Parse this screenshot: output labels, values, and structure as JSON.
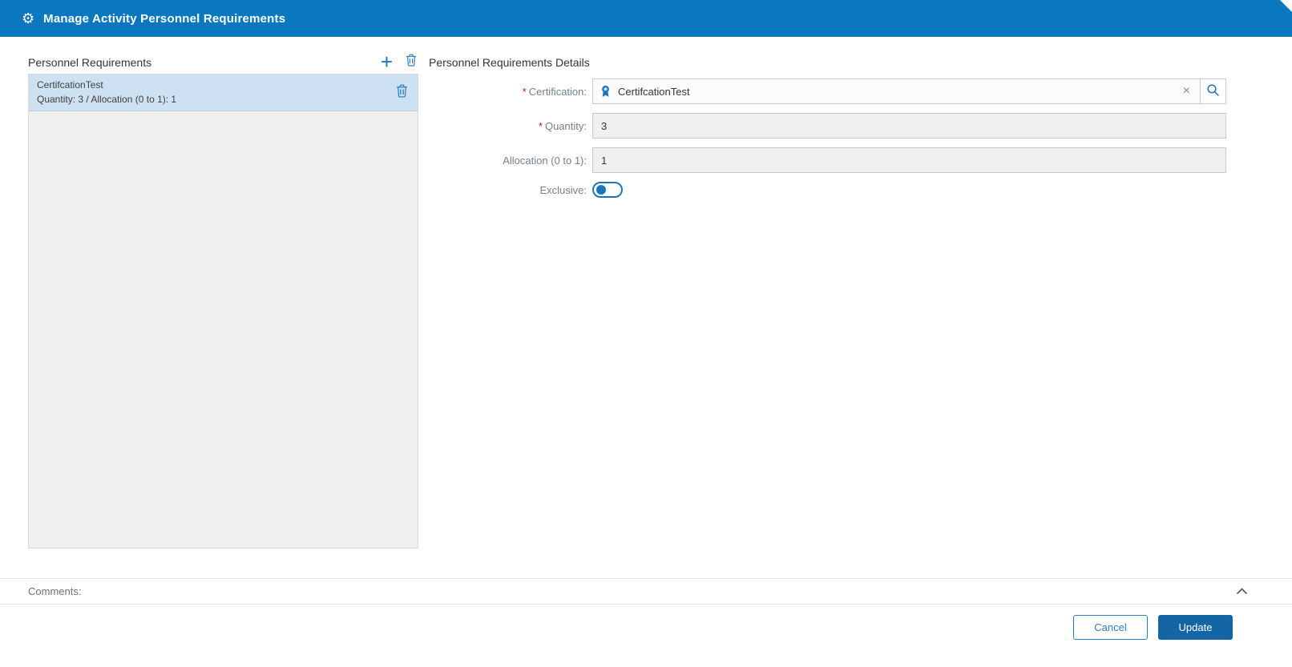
{
  "colors": {
    "header_bg": "#0a78be",
    "accent_blue": "#1b75bb",
    "selected_item_bg": "#cde1f2",
    "input_bg": "#f0f0f0",
    "update_button_bg": "#1465a4",
    "cancel_button_border": "#2a7fc0",
    "required_red": "#b42025"
  },
  "icons": {
    "gear": "⚙",
    "plus": "+",
    "clear": "×"
  },
  "header": {
    "title": "Manage Activity Personnel Requirements"
  },
  "left_panel": {
    "title": "Personnel Requirements",
    "items": [
      {
        "name": "CertifcationTest",
        "details": "Quantity: 3 /  Allocation (0 to 1): 1"
      }
    ]
  },
  "details": {
    "title": "Personnel Requirements Details",
    "certification": {
      "required": "*",
      "label": "Certification:",
      "value": "CertifcationTest"
    },
    "quantity": {
      "required": "*",
      "label": "Quantity:",
      "value": "3"
    },
    "allocation": {
      "label": "Allocation (0 to 1):",
      "value": "1"
    },
    "exclusive": {
      "label": "Exclusive:",
      "state": "off"
    }
  },
  "comments": {
    "label": "Comments:"
  },
  "footer": {
    "cancel_label": "Cancel",
    "update_label": "Update"
  }
}
